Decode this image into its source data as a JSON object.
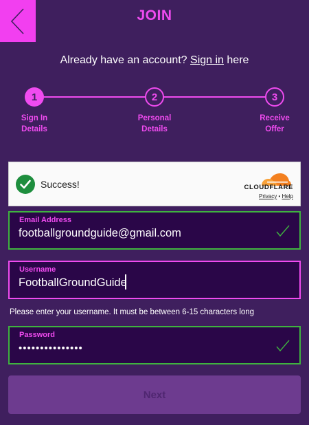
{
  "header": {
    "title": "JOIN",
    "back_icon": "chevron-left-icon"
  },
  "signin_prompt": {
    "before": "Already have an account? ",
    "link": "Sign in",
    "after": " here"
  },
  "stepper": {
    "steps": [
      {
        "number": "1",
        "label_line1": "Sign In",
        "label_line2": "Details",
        "state": "active"
      },
      {
        "number": "2",
        "label_line1": "Personal",
        "label_line2": "Details",
        "state": "inactive"
      },
      {
        "number": "3",
        "label_line1": "Receive",
        "label_line2": "Offer",
        "state": "inactive"
      }
    ]
  },
  "captcha": {
    "status": "Success!",
    "brand": "CLOUDFLARE",
    "privacy": "Privacy",
    "separator": "•",
    "help": "Help"
  },
  "form": {
    "email": {
      "label": "Email Address",
      "value": "footballgroundguide@gmail.com",
      "state": "valid"
    },
    "username": {
      "label": "Username",
      "value": "FootballGroundGuide",
      "state": "focused",
      "helper": "Please enter your username. It must be between 6-15 characters long"
    },
    "password": {
      "label": "Password",
      "value": "•••••••••••••••",
      "state": "valid"
    }
  },
  "next_button": {
    "label": "Next",
    "state": "disabled"
  },
  "colors": {
    "background": "#3f1f5e",
    "accent": "#f04bf0",
    "field_bg": "#2a0648",
    "valid": "#3fb33f",
    "button_disabled": "#6d3b8f"
  }
}
